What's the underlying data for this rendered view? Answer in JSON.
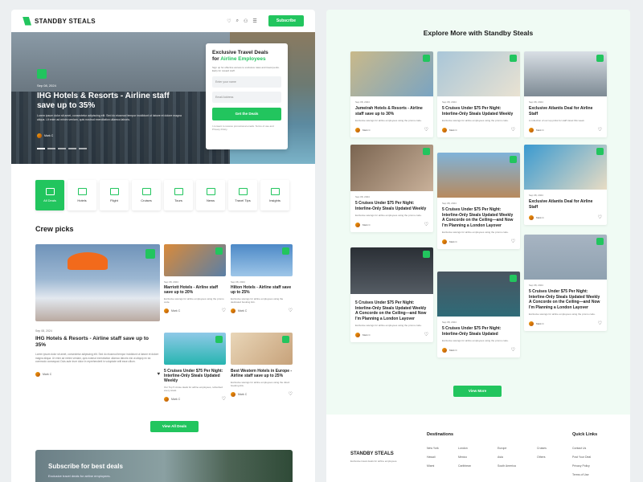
{
  "brand": {
    "name": "STANDBY STEALS",
    "accent": "#22c55e"
  },
  "header": {
    "subscribe_label": "Subscribe"
  },
  "hero": {
    "date": "Sep 08, 2024",
    "title": "IHG Hotels & Resorts - Airline staff save up to 35%",
    "desc": "Lorem ipsum dolor sit amet, consectetur adipiscing elit. Sed do eiusmod tempor incididunt ut labore et dolore magna aliqua. Ut enim ad minim veniam, quis nostrud exercitation ullamco laboris.",
    "author": "Mark C"
  },
  "deal_form": {
    "title_a": "Exclusive Travel Deals",
    "title_b_prefix": "for ",
    "title_b_accent": "Airline Employees",
    "blurb": "Sign up for effective access to exclusive rates and travel perks. Early for reward staff.",
    "name_placeholder": "Enter your name",
    "email_placeholder": "Email Address",
    "button": "Get the Deals",
    "legal": "I consent to receive promotional emails. Terms of use and Privacy Policy."
  },
  "categories": [
    {
      "label": "All Deals",
      "active": true
    },
    {
      "label": "Hotels"
    },
    {
      "label": "Flight"
    },
    {
      "label": "Cruises"
    },
    {
      "label": "Tours"
    },
    {
      "label": "News"
    },
    {
      "label": "Travel Tips"
    },
    {
      "label": "Insights"
    }
  ],
  "crew": {
    "title": "Crew picks",
    "big": {
      "date": "Sep 08, 2024",
      "title": "IHG Hotels & Resorts - Airline staff save up to 35%",
      "desc": "Lorem ipsum dolor sit amet, consectetur adipiscing elit. Sed do eiusmod tempor incididunt ut labore et dolore magna aliqua. Ut enim ad minim veniam, quis nostrud exercitation ullamco laboris nisi ut aliquip ex ea commodo consequat. Duis aute irure dolor in reprehenderit in voluptate velit esse cillum.",
      "author": "Mark C"
    },
    "small": [
      {
        "date": "Sep 08, 2024",
        "title": "Marriott Hotels - Airline staff save up to 20%",
        "desc": "Exclusive savings for airline employees using the promo code.",
        "author": "Mark C"
      },
      {
        "date": "Sep 08, 2024",
        "title": "Hilton Hotels - Airline staff save up to 25%",
        "desc": "Exclusive savings for airline employees using the dedicated booking link.",
        "author": "Mark C"
      },
      {
        "date": "",
        "title": "5 Cruises Under $75 Per Night: Interline-Only Steals Updated Weekly",
        "desc": "Our Top 5 cruise deals for airline employees, refreshed every week.",
        "author": "Mark C"
      },
      {
        "date": "",
        "title": "Best Western Hotels in Europe - Airline staff save up to 25%",
        "desc": "Exclusive savings for airline employees using the direct booking link.",
        "author": "Mark C"
      }
    ],
    "view_all": "View All Deals"
  },
  "subscribe": {
    "title": "Subscribe for best deals",
    "text": "Exclusive travel deals for airline employees."
  },
  "explore": {
    "title": "Explore More with Standby Steals",
    "cards": [
      {
        "date": "Sep 08, 2024",
        "title": "Jumeirah Hotels & Resorts - Airline staff save up to 30%",
        "desc": "Exclusive savings for airline employees using the promo code.",
        "author": "Mark C"
      },
      {
        "date": "Sep 08, 2024",
        "title": "5 Cruises Under $75 Per Night: Interline-Only Steals Updated Weekly",
        "desc": "Exclusive savings for airline employees using the promo code.",
        "author": "Mark C"
      },
      {
        "date": "Sep 08, 2024",
        "title": "Exclusive Atlantis Deal for Airline Staff",
        "desc": "A collection of our top picks for staff travel this week.",
        "author": "Mark C"
      },
      {
        "date": "Sep 08, 2024",
        "title": "5 Cruises Under $75 Per Night: Interline-Only Steals Updated Weekly",
        "desc": "Exclusive savings for airline employees using the promo code.",
        "author": "Mark C"
      },
      {
        "date": "Sep 08, 2024",
        "title": "5 Cruises Under $75 Per Night: Interline-Only Steals Updated Weekly A Concorde on the Ceiling—and Now I'm Planning a London Layover",
        "desc": "Exclusive savings for airline employees using the promo code.",
        "author": "Mark C"
      },
      {
        "date": "Sep 08, 2024",
        "title": "Exclusive Atlantis Deal for Airline Staff",
        "desc": "",
        "author": "Mark C"
      },
      {
        "date": "",
        "title": "5 Cruises Under $75 Per Night: Interline-Only Steals Updated Weekly A Concorde on the Ceiling—and Now I'm Planning a London Layover",
        "desc": "Exclusive savings for airline employees using the promo code.",
        "author": "Mark C"
      },
      {
        "date": "Sep 08, 2024",
        "title": "5 Cruises Under $75 Per Night: Interline-Only Steals Updated",
        "desc": "Exclusive savings for airline employees using the promo code.",
        "author": "Mark C"
      },
      {
        "date": "Sep 08, 2024",
        "title": "5 Cruises Under $75 Per Night: Interline-Only Steals Updated Weekly A Concorde on the Ceiling—and Now I'm Planning a London Layover",
        "desc": "Exclusive savings for airline employees using the promo code.",
        "author": "Mark C"
      }
    ],
    "view_more": "View More"
  },
  "footer": {
    "brand": "STANDBY STEALS",
    "tagline": "Exclusive travel deals for airline employees.",
    "destinations_title": "Destinations",
    "destinations": [
      "New York",
      "London",
      "Europe",
      "Cruises",
      "Hawaii",
      "Mexico",
      "Asia",
      "Others",
      "Miami",
      "Caribbean",
      "South America"
    ],
    "quick_title": "Quick Links",
    "quick": [
      "Contact Us",
      "Post Your Deal",
      "Privacy Policy",
      "Terms of Use"
    ]
  }
}
